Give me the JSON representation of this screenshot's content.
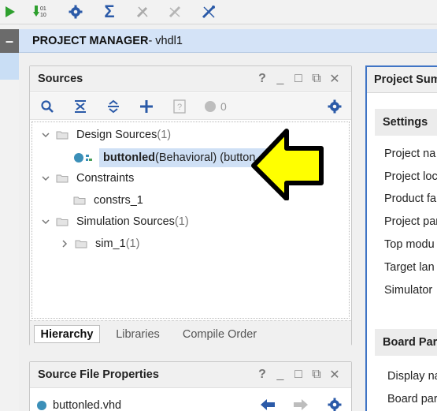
{
  "toolbar": {
    "icons": [
      "run-icon",
      "download-bitstream-icon",
      "settings-gear-icon",
      "sigma-icon",
      "wand-icon",
      "probe-icon",
      "debug-icon"
    ]
  },
  "left_strip": {
    "collapse_label": "–"
  },
  "project_manager": {
    "label": "PROJECT MANAGER",
    "project": " - vhdl1"
  },
  "sources": {
    "title": "Sources",
    "controls": [
      "?",
      "_",
      "□",
      "⧉",
      "✕"
    ],
    "toolbar_count": "0",
    "tree": {
      "design_sources": {
        "label": "Design Sources",
        "count": " (1)"
      },
      "top_file": {
        "name": "buttonled",
        "detail": "(Behavioral) (button"
      },
      "constraints": {
        "label": "Constraints"
      },
      "constrs": {
        "label": "constrs_1"
      },
      "simulation_sources": {
        "label": "Simulation Sources",
        "count": " (1)"
      },
      "sim": {
        "label": "sim_1",
        "count": " (1)"
      }
    },
    "tabs": [
      "Hierarchy",
      "Libraries",
      "Compile Order"
    ]
  },
  "source_file_properties": {
    "title": "Source File Properties",
    "file": "buttonled.vhd"
  },
  "project_summary": {
    "title": "Project Sum",
    "settings_heading": "Settings",
    "settings_items": [
      "Project na",
      "Project loc",
      "Product fa",
      "Project par",
      "Top modu",
      "Target lan",
      "Simulator"
    ],
    "board_heading": "Board Part",
    "board_items": [
      "Display na",
      "Board par"
    ]
  },
  "colors": {
    "accent_blue": "#3f74c5",
    "header_blue": "#d4e3f7",
    "selection": "#cfe0f5",
    "arrow_yellow": "#ffff00"
  }
}
